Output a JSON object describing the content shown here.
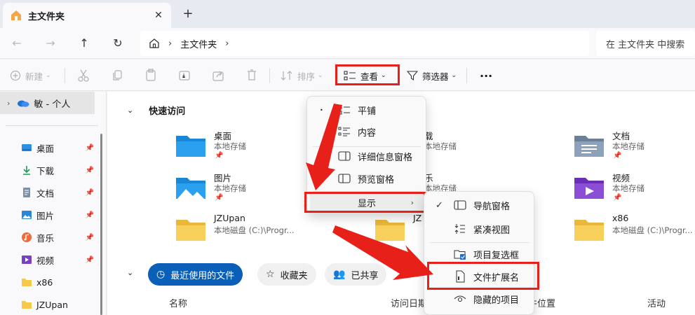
{
  "tab": {
    "title": "主文件夹",
    "close": "✕",
    "new_tab": "+"
  },
  "address": {
    "crumb": "主文件夹",
    "sep": "›",
    "sep2": "›",
    "search_placeholder": "在 主文件夹 中搜索"
  },
  "nav": {
    "back": "←",
    "forward": "→",
    "up": "↑",
    "refresh": "↻"
  },
  "toolbar": {
    "new_label": "新建",
    "sort_label": "排序",
    "view_label": "查看",
    "filter_label": "筛选器",
    "more": "···"
  },
  "sidebar": {
    "personal": "敏 - 个人",
    "items": [
      {
        "label": "桌面"
      },
      {
        "label": "下载"
      },
      {
        "label": "文档"
      },
      {
        "label": "图片"
      },
      {
        "label": "音乐"
      },
      {
        "label": "视频"
      },
      {
        "label": "x86"
      },
      {
        "label": "JZUpan"
      }
    ]
  },
  "main": {
    "quick_access": "快速访问",
    "qa_items": [
      {
        "name": "桌面",
        "sub": "本地存储"
      },
      {
        "name": "载",
        "sub": "本地存储"
      },
      {
        "name": "文档",
        "sub": "本地存储"
      },
      {
        "name": "图片",
        "sub": "本地存储"
      },
      {
        "name": "乐",
        "sub": "本地存储"
      },
      {
        "name": "视频",
        "sub": "本地存储"
      },
      {
        "name": "JZUpan",
        "sub": "本地磁盘 (C:)\\Progr..."
      },
      {
        "name": "JZ",
        "sub": ""
      },
      {
        "name": "x86",
        "sub": "本地磁盘 (C:)\\Progr..."
      }
    ],
    "chips": {
      "recent": "最近使用的文件",
      "favorites": "收藏夹",
      "shared": "已共享"
    },
    "columns": {
      "name": "名称",
      "access_date": "访问日期",
      "location": "件位置",
      "activity": "活动"
    }
  },
  "view_menu": {
    "tiles": "平铺",
    "content": "内容",
    "details_pane": "详细信息窗格",
    "preview_pane": "预览窗格",
    "show": "显示",
    "bullet": "•",
    "arrow": "›"
  },
  "show_menu": {
    "nav_pane": "导航窗格",
    "compact": "紧凑视图",
    "checkbox": "项目复选框",
    "extensions": "文件扩展名",
    "hidden": "隐藏的项目",
    "check": "✓"
  },
  "colors": {
    "highlight": "#e8201a",
    "accent": "#0a5fb8"
  }
}
